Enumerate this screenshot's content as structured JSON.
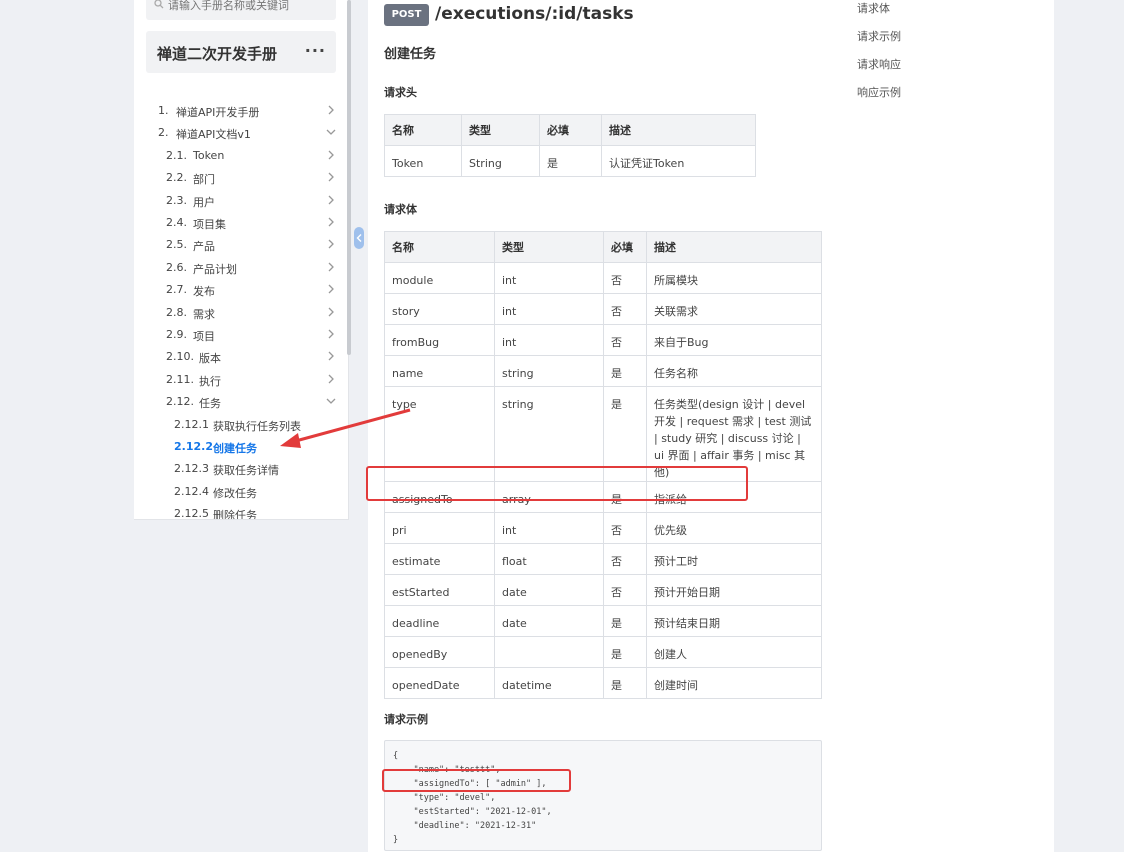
{
  "sidebar": {
    "search_placeholder": "请输入手册名称或关键词",
    "book_title": "禅道二次开发手册",
    "more_label": "···",
    "toc": [
      {
        "num": "1.",
        "label": "禅道API开发手册",
        "chevron": "right",
        "level": 1
      },
      {
        "num": "2.",
        "label": "禅道API文档v1",
        "chevron": "down",
        "level": 1
      },
      {
        "num": "2.1.",
        "label": "Token",
        "chevron": "right",
        "level": 2
      },
      {
        "num": "2.2.",
        "label": "部门",
        "chevron": "right",
        "level": 2
      },
      {
        "num": "2.3.",
        "label": "用户",
        "chevron": "right",
        "level": 2
      },
      {
        "num": "2.4.",
        "label": "项目集",
        "chevron": "right",
        "level": 2
      },
      {
        "num": "2.5.",
        "label": "产品",
        "chevron": "right",
        "level": 2
      },
      {
        "num": "2.6.",
        "label": "产品计划",
        "chevron": "right",
        "level": 2
      },
      {
        "num": "2.7.",
        "label": "发布",
        "chevron": "right",
        "level": 2
      },
      {
        "num": "2.8.",
        "label": "需求",
        "chevron": "right",
        "level": 2
      },
      {
        "num": "2.9.",
        "label": "项目",
        "chevron": "right",
        "level": 2
      },
      {
        "num": "2.10.",
        "label": "版本",
        "chevron": "right",
        "level": 2
      },
      {
        "num": "2.11.",
        "label": "执行",
        "chevron": "right",
        "level": 2
      },
      {
        "num": "2.12.",
        "label": "任务",
        "chevron": "down",
        "level": 2
      },
      {
        "num": "2.12.1",
        "label": "获取执行任务列表",
        "chevron": "",
        "level": 3
      },
      {
        "num": "2.12.2",
        "label": "创建任务",
        "chevron": "",
        "level": 3,
        "active": true
      },
      {
        "num": "2.12.3",
        "label": "获取任务详情",
        "chevron": "",
        "level": 3
      },
      {
        "num": "2.12.4",
        "label": "修改任务",
        "chevron": "",
        "level": 3
      },
      {
        "num": "2.12.5",
        "label": "删除任务",
        "chevron": "",
        "level": 3
      }
    ]
  },
  "main": {
    "method": "POST",
    "endpoint": "/executions/:id/tasks",
    "title": "创建任务",
    "headers_section": "请求头",
    "body_section": "请求体",
    "example_section": "请求示例",
    "columns": [
      "名称",
      "类型",
      "必填",
      "描述"
    ],
    "headers_rows": [
      [
        "Token",
        "String",
        "是",
        "认证凭证Token"
      ]
    ],
    "body_rows": [
      [
        "module",
        "int",
        "否",
        "所属模块"
      ],
      [
        "story",
        "int",
        "否",
        "关联需求"
      ],
      [
        "fromBug",
        "int",
        "否",
        "来自于Bug"
      ],
      [
        "name",
        "string",
        "是",
        "任务名称"
      ],
      [
        "type",
        "string",
        "是",
        "任务类型(design 设计 | devel 开发 | request 需求 | test 测试 | study 研究 | discuss 讨论 | ui 界面 | affair 事务 | misc 其他)"
      ],
      [
        "assignedTo",
        "array",
        "是",
        "指派给"
      ],
      [
        "pri",
        "int",
        "否",
        "优先级"
      ],
      [
        "estimate",
        "float",
        "否",
        "预计工时"
      ],
      [
        "estStarted",
        "date",
        "否",
        "预计开始日期"
      ],
      [
        "deadline",
        "date",
        "是",
        "预计结束日期"
      ],
      [
        "openedBy",
        "",
        "是",
        "创建人"
      ],
      [
        "openedDate",
        "datetime",
        "是",
        "创建时间"
      ]
    ],
    "example_code": "{\n    \"name\": \"testtt\",\n    \"assignedTo\": [ \"admin\" ],\n    \"type\": \"devel\",\n    \"estStarted\": \"2021-12-01\",\n    \"deadline\": \"2021-12-31\"\n}"
  },
  "right_toc": [
    "请求体",
    "请求示例",
    "请求响应",
    "响应示例"
  ],
  "colors": {
    "accent": "#1677e8",
    "annotation": "#e23b3b",
    "badge": "#6b7280"
  }
}
